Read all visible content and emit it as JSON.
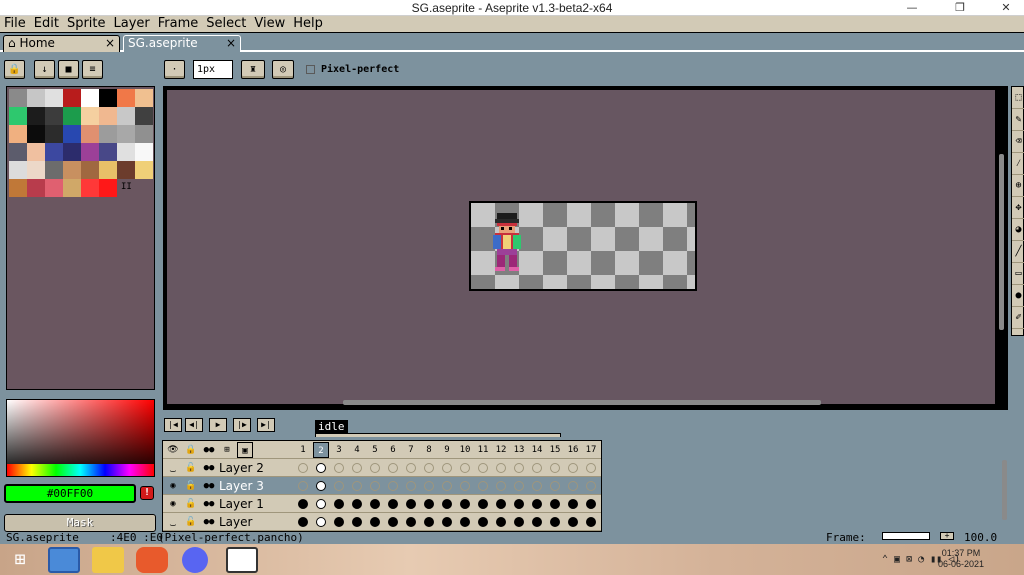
{
  "window": {
    "title": "SG.aseprite - Aseprite v1.3-beta2-x64",
    "minimize": "—",
    "maximize": "❐",
    "close": "✕"
  },
  "menu": [
    "File",
    "Edit",
    "Sprite",
    "Layer",
    "Frame",
    "Select",
    "View",
    "Help"
  ],
  "tabs": [
    {
      "label": "Home",
      "close": "×"
    },
    {
      "label": "SG.aseprite",
      "close": "×"
    }
  ],
  "toolbar": {
    "brush_size": "1px",
    "pixel_perfect_label": "Pixel-perfect"
  },
  "palette": {
    "swatches": [
      "#8a8a8a",
      "#c6c6c6",
      "#e0e0e0",
      "#b81c1c",
      "#ffffff",
      "#000000",
      "#f07848",
      "#f0c090",
      "#2ec86e",
      "#1c1c1c",
      "#3c3c3c",
      "#1c9c4c",
      "#f5d0a0",
      "#f0b890",
      "#c8c8c8",
      "#404040",
      "#f0b080",
      "#0c0c0c",
      "#2c2c2c",
      "#2848b0",
      "#e09070",
      "#9c9c9c",
      "#a8a8a8",
      "#909090",
      "#5c5c6c",
      "#f0c0a0",
      "#3c48a0",
      "#2c2c6c",
      "#9c4098",
      "#484888",
      "#e0e0e0",
      "#f8f8f8",
      "#dcdcdc",
      "#ecd8c8",
      "#6c6c6c",
      "#c89060",
      "#a06840",
      "#e8c068",
      "#6c3c2c",
      "#f0d078",
      "#c07838",
      "#b83c4c",
      "#e06070",
      "#d0a868",
      "#ff3838",
      "#ff1818"
    ],
    "extra": "II"
  },
  "color": {
    "hex": "#00FF00",
    "value": "#00ff00",
    "mask_label": "Mask"
  },
  "timeline": {
    "tag": "idle",
    "frames": [
      "1",
      "2",
      "3",
      "4",
      "5",
      "6",
      "7",
      "8",
      "9",
      "10",
      "11",
      "12",
      "13",
      "14",
      "15",
      "16",
      "17"
    ],
    "current_frame": 2,
    "layers": [
      {
        "name": "Layer 2",
        "visible": false,
        "cels": "empty"
      },
      {
        "name": "Layer 3",
        "visible": true,
        "cels": "empty",
        "selected": true
      },
      {
        "name": "Layer 1",
        "visible": true,
        "cels": "filled"
      },
      {
        "name": "Layer",
        "visible": false,
        "cels": "filled"
      }
    ]
  },
  "status": {
    "file": "SG.aseprite",
    "coords": ":4E0 :E0",
    "note": "(Pixel-perfect.pancho)",
    "frame_label": "Frame:",
    "zoom": "100.0"
  },
  "taskbar": {
    "time": "01:37 PM",
    "date": "06-06-2021"
  }
}
